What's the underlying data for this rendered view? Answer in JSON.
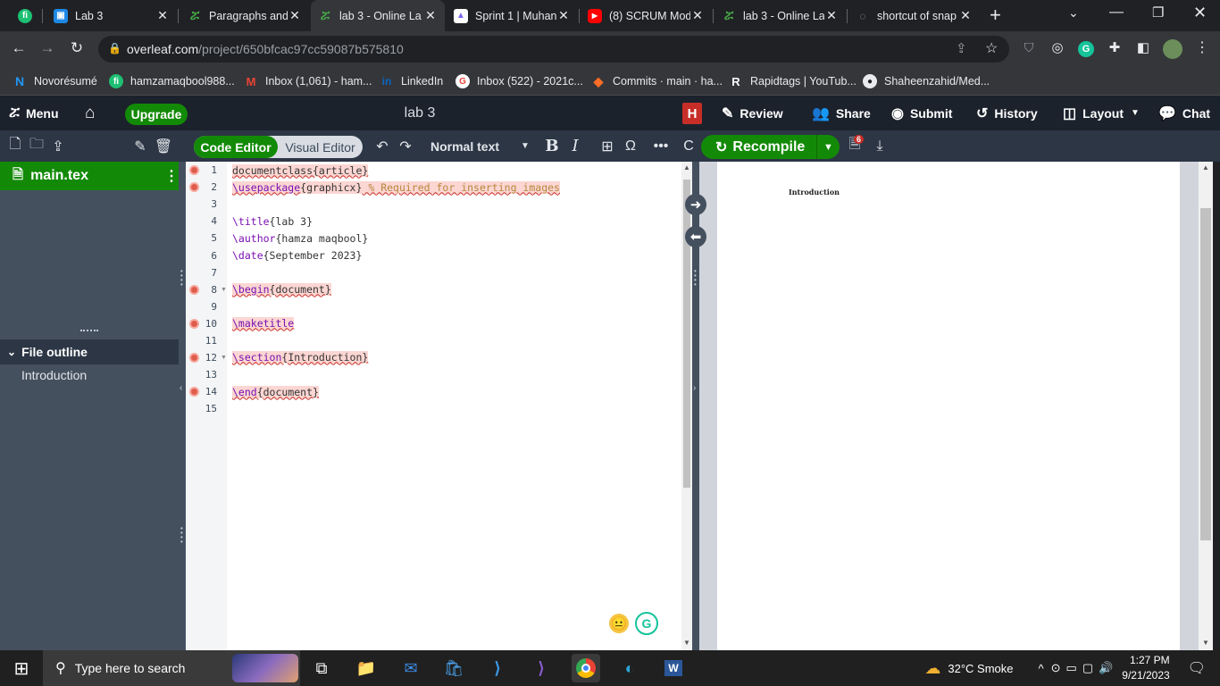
{
  "browser": {
    "tabs": [
      {
        "title": "",
        "favicon": "google-meet-icon",
        "active": false,
        "color": "#1a73e8"
      },
      {
        "title": "Lab 3",
        "favicon": "google-classroom-icon",
        "active": false,
        "color": "#1e88e5"
      },
      {
        "title": "Paragraphs and",
        "favicon": "overleaf-icon",
        "active": false,
        "color": "#138a07"
      },
      {
        "title": "lab 3 - Online La",
        "favicon": "overleaf-icon",
        "active": true,
        "color": "#138a07"
      },
      {
        "title": "Sprint 1 | Muhan",
        "favicon": "clickup-icon",
        "active": false,
        "color": "#7b68ee"
      },
      {
        "title": "(8) SCRUM Mod",
        "favicon": "youtube-icon",
        "active": false,
        "color": "#ff0000"
      },
      {
        "title": "lab 3 - Online La",
        "favicon": "overleaf-icon",
        "active": false,
        "color": "#138a07"
      },
      {
        "title": "shortcut of snap",
        "favicon": "loading-icon",
        "active": false,
        "color": "#5f6368"
      }
    ],
    "url_host": "overleaf.com",
    "url_path": "/project/650bfcac97cc59087b575810",
    "bookmarks": [
      {
        "label": "Novorésumé",
        "icon": "novoresume-icon",
        "color": "#2196f3"
      },
      {
        "label": "hamzamaqbool988...",
        "icon": "fiverr-icon",
        "color": "#1dbf73"
      },
      {
        "label": "Inbox (1,061) - ham...",
        "icon": "gmail-icon",
        "color": "#ea4335"
      },
      {
        "label": "LinkedIn",
        "icon": "linkedin-icon",
        "color": "#0a66c2"
      },
      {
        "label": "Inbox (522) - 2021c...",
        "icon": "google-icon",
        "color": "#ffffff"
      },
      {
        "label": "Commits · main · ha...",
        "icon": "gitlab-icon",
        "color": "#fc6d26"
      },
      {
        "label": "Rapidtags | YouTub...",
        "icon": "rapidtags-icon",
        "color": "#202124"
      },
      {
        "label": "Shaheenzahid/Med...",
        "icon": "github-icon",
        "color": "#202124"
      }
    ]
  },
  "header": {
    "menu": "Menu",
    "upgrade": "Upgrade",
    "project_name": "lab 3",
    "user_badge": "H",
    "review": "Review",
    "share": "Share",
    "submit": "Submit",
    "history": "History",
    "layout": "Layout",
    "chat": "Chat"
  },
  "toolbar": {
    "code_editor": "Code Editor",
    "visual_editor": "Visual Editor",
    "style_select": "Normal text",
    "recompile": "Recompile",
    "log_badge": "6"
  },
  "sidebar": {
    "file": "main.tex",
    "outline_title": "File outline",
    "outline_items": [
      "Introduction"
    ]
  },
  "editor": {
    "lines": [
      {
        "n": "1",
        "err": true,
        "fold": false
      },
      {
        "n": "2",
        "err": true,
        "fold": false
      },
      {
        "n": "3",
        "err": false,
        "fold": false
      },
      {
        "n": "4",
        "err": false,
        "fold": false
      },
      {
        "n": "5",
        "err": false,
        "fold": false
      },
      {
        "n": "6",
        "err": false,
        "fold": false
      },
      {
        "n": "7",
        "err": false,
        "fold": false
      },
      {
        "n": "8",
        "err": true,
        "fold": true
      },
      {
        "n": "9",
        "err": false,
        "fold": false
      },
      {
        "n": "10",
        "err": true,
        "fold": false
      },
      {
        "n": "11",
        "err": false,
        "fold": false
      },
      {
        "n": "12",
        "err": true,
        "fold": true
      },
      {
        "n": "13",
        "err": false,
        "fold": false
      },
      {
        "n": "14",
        "err": true,
        "fold": false
      },
      {
        "n": "15",
        "err": false,
        "fold": false
      }
    ],
    "code": {
      "l1": "documentclass{article}",
      "l2_cmd": "\\usepackage",
      "l2_arg": "{graphicx}",
      "l2_comment": " % Required for inserting images",
      "l4_cmd": "\\title",
      "l4_arg": "{lab 3}",
      "l5_cmd": "\\author",
      "l5_arg": "{hamza maqbool}",
      "l6_cmd": "\\date",
      "l6_arg": "{September 2023}",
      "l8_cmd": "\\begin",
      "l8_arg": "{document}",
      "l10_cmd": "\\maketitle",
      "l12_cmd": "\\section",
      "l12_arg": "{Introduction}",
      "l14_cmd": "\\end",
      "l14_arg": "{document}"
    }
  },
  "pdf": {
    "heading": "Introduction"
  },
  "taskbar": {
    "search_placeholder": "Type here to search",
    "weather": "32°C  Smoke",
    "time": "1:27 PM",
    "date": "9/21/2023"
  }
}
